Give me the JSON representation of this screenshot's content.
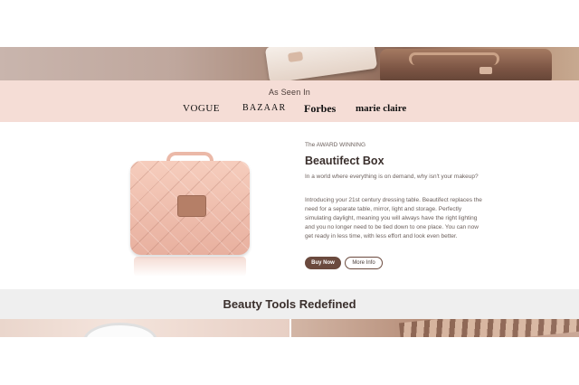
{
  "as_seen_in": {
    "title": "As Seen In",
    "logos": [
      "VOGUE",
      "BAZAAR",
      "Forbes",
      "marie claire"
    ]
  },
  "product": {
    "eyebrow": "The AWARD WINNING",
    "title": "Beautifect Box",
    "intro": "In a world where everything is on demand, why isn't your makeup?",
    "description": "Introducing your 21st century dressing table. Beautifect replaces the need for a separate table, mirror, light and storage. Perfectly simulating daylight, meaning you will always have the right lighting and you no longer need to be tied down to one place. You can now get ready in less time, with less effort and look even better.",
    "buy_label": "Buy Now",
    "more_label": "More Info"
  },
  "tools": {
    "title": "Beauty Tools Redefined"
  },
  "colors": {
    "band_pink": "#f5ddd6",
    "button_brown": "#6b4a3e",
    "grey_band": "#efefef"
  }
}
